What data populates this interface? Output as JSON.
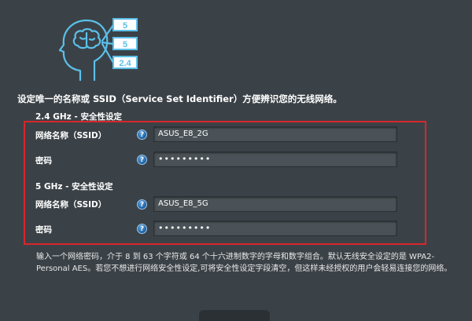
{
  "illustration": {
    "tags": [
      "5",
      "5",
      "2.4"
    ]
  },
  "intro_text": "设定唯一的名称或 SSID（Service Set Identifier）方便辨识您的无线网络。",
  "band_24": {
    "title": "2.4 GHz - 安全性设定",
    "ssid_label": "网络名称（SSID）",
    "ssid_value": "ASUS_E8_2G",
    "password_label": "密码",
    "password_value": "•••••••••"
  },
  "band_5": {
    "title": "5 GHz - 安全性设定",
    "ssid_label": "网络名称（SSID）",
    "ssid_value": "ASUS_E8_5G",
    "password_label": "密码",
    "password_value": "•••••••••"
  },
  "help_glyph": "?",
  "hint_text": "输入一个网络密码，介于 8 到 63 个字符或 64 个十六进制数字的字母和数字组合。默认无线安全设定的是 WPA2-Personal AES。若您不想进行网络安全性设定,可将安全性设定字段清空，但这样未经授权的用户会轻易连接您的网络。",
  "colors": {
    "background": "#3b4247",
    "highlight_border": "#d8262b",
    "help_icon": "#2a6fb5"
  }
}
